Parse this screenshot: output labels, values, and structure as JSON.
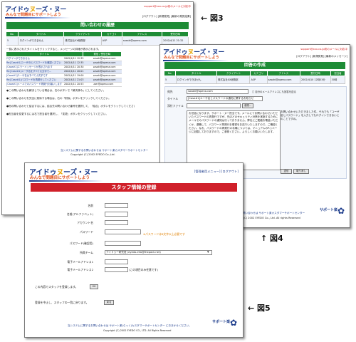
{
  "callouts": {
    "fig3": "図3",
    "fig4": "図4",
    "fig5": "図5"
  },
  "brand": {
    "logo_line1a": "アイドゥ",
    "logo_o": "ヌ",
    "logo_line1b": "ーズ・ヌー",
    "logo_line2": "みんなで問題目にサポートしよう",
    "footer_mark": "サポート楽"
  },
  "fig3": {
    "support_email": "support@xxx.co.jp宛のメールに対応中",
    "nav": "[ログアウト] [新規発見] [最新の発見結果]",
    "title": "問い合わせの履歴",
    "table_headers": [
      "No.",
      "タイトル",
      "クライアント",
      "カテゴリ",
      "アドレス",
      "受付日時"
    ],
    "table_row": [
      "5",
      "ログインができません",
      "株式会社XX総務部",
      "ASP",
      "sasaki@opena.com",
      "2002/4/11 21:32"
    ],
    "list_title": "一覧に表示されたタイトルをクリックすると、メッセージの詳細が表示されます。",
    "list_headers": [
      "タイトル",
      "発信 / 受信日時"
    ],
    "list_rows": [
      [
        "ログインができません",
        "2002/4/11 12:35",
        "sasaki@opena.com"
      ],
      [
        "Re:[Case#1]ユーザIDとパスワードを確認ください",
        "2002/4/11 12:35",
        "sasaki@opena.com"
      ],
      [
        "[Case#1]エラーメッセージが表示されます",
        "2002/4/11 20:30",
        "sasaki@opena.com"
      ],
      [
        "Re:[Case#1]ユーザ名をすべて大文字で...",
        "2002/4/11 20:01",
        "sasaki@opena.com"
      ],
      [
        "[Case#1]ユーザ名はすべて小文字です",
        "2002/4/11 19:00",
        "sasaki@opena.com"
      ],
      [
        "Re:[Case#1]パスワードを再発行してください",
        "2002/4/11 21:03",
        "sasaki@opena.com"
      ],
      [
        "[Case#1]メールでのパスワード再発行お願いします",
        "2002/4/11 20:53",
        "user@opena.com"
      ]
    ],
    "notes": [
      "●この問い合わせを解決している場合は、右のボタンで「解決済み」にしてください。",
      "●この問い合わせを完全に削除する場合は、右の「削除」ボタンをクリックしてください。",
      "●他の問い合わせと結合するには、結合先の問い合わせ番号を選択して、「結合」ボタンをクリックしてください。",
      "●担当者を変更するには右で担当者を選択し、「変更」ボタンをクリックしてください。"
    ],
    "footer": "当システムに関するお問い合わせは サポート楽カスタマーサポートセンター",
    "copyright": "Copyright (C) 2002 EYEDO Co.,Ltd."
  },
  "fig4": {
    "support_email": "support@xxx.co.jp宛のメールに対応中",
    "nav": "[ログアウト] [新規発見] [最新のメッセージ]",
    "title": "回答の作成",
    "table_headers": [
      "No.",
      "タイトル",
      "クライアント",
      "カテゴリ",
      "アドレス",
      "受付日時",
      "担当者"
    ],
    "table_row": [
      "5",
      "ログインができません",
      "株式会社XX総務部",
      "ASP",
      "sasaki@opena.com",
      "2002/4/10 12時03分",
      "30時"
    ],
    "to_label": "宛先",
    "to_value": "sasaki@opena.com",
    "cc_label": "□ 自分のメールアドレスにも回答を送る",
    "subject_label": "タイトル",
    "subject_value": "[Case#1]ユーザ名とパスワードの通知に関するお知らせ",
    "attach_label": "添付ファイル",
    "browse_label": "参照...",
    "body_text": "お世話になります。サポート・ヌー担当です。メールにてお問い合わせいただいたパスワードの再発行ですが、先ほどのセキュリティ対策を実施するためにメールでのパスワードの通知は行っておりません。弊社にご連絡お電話いただくか、退職して、パスワード再発行手順書をお送りいたしますので、ご確認ください。なお、パスワードの再発行の手順については、マニュアルのP.○ページに記載しておりますので、ご参照ください。よろしくお願いいたします。",
    "side_text": "お問い合わせいただきました件、それでも「ユーザ名とパスワード」を入力してもログインできないとのことですね。",
    "send_button": "送信",
    "cancel_button": "取り消し",
    "footer": "当システムに関するお問い合わせは サポート楽カスタマーサポートセンター",
    "copyright": "Copyright (C) 2002 EYEDO Co., Ltd. All rights Reserved"
  },
  "fig5": {
    "nav": "[管理者用メニュー] [ログアウト]",
    "title": "スタッフ情報の登録",
    "fields": [
      {
        "label": "名前",
        "value": ""
      },
      {
        "label": "名前(アルファベット)",
        "value": ""
      },
      {
        "label": "アカウント名",
        "value": ""
      },
      {
        "label": "パスワード",
        "value": ""
      },
      {
        "label": "パスワード(確認用)",
        "value": ""
      },
      {
        "label": "所属チーム",
        "value": "アイドゥー研究班 (eyedo-info@thepack.net)"
      },
      {
        "label": "電子メールアドレス1",
        "value": ""
      },
      {
        "label": "電子メールアドレス2",
        "value": ""
      }
    ],
    "password_hint": "※パスワードは8文字以上必要です",
    "email2_hint": "(この項目のみ任意です)",
    "submit_text": "この内容でスタッフを登録します。",
    "ok_button": "OK",
    "cancel_text": "登録を中止し、スタッフの一覧に戻ります。",
    "back_button": "戻る",
    "footer": "当システムに関するお問い合わせは サポート楽(らっく)カスタマーサポートセンター におまかせください。",
    "copyright": "Copyright (C) 2002 EYEDO CO., LTD. All Rights Reserved"
  }
}
